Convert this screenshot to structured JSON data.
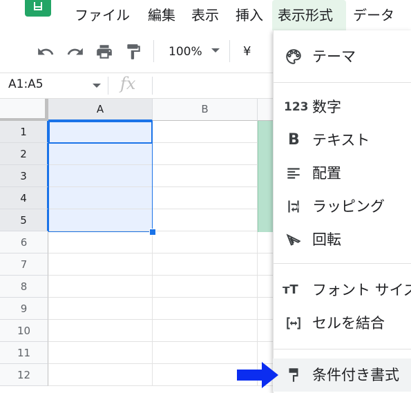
{
  "menu": {
    "items": [
      {
        "label": "ファイル"
      },
      {
        "label": "編集"
      },
      {
        "label": "表示"
      },
      {
        "label": "挿入"
      },
      {
        "label": "表示形式",
        "active": true
      },
      {
        "label": "データ"
      }
    ]
  },
  "toolbar": {
    "zoom": "100%",
    "currency": "¥",
    "icons": [
      "undo-icon",
      "redo-icon",
      "print-icon",
      "paint-format-icon"
    ]
  },
  "formula_bar": {
    "name_box": "A1:A5",
    "fx_label": "fx"
  },
  "grid": {
    "columns": [
      "A",
      "B"
    ],
    "rows": [
      "1",
      "2",
      "3",
      "4",
      "5",
      "6",
      "7",
      "8",
      "9",
      "10",
      "11",
      "12"
    ],
    "selected_range": "A1:A5"
  },
  "format_menu": {
    "items": [
      {
        "label": "テーマ",
        "icon": "palette-icon"
      },
      {
        "label": "数字",
        "icon": "number-123-icon"
      },
      {
        "label": "テキスト",
        "icon": "bold-icon"
      },
      {
        "label": "配置",
        "icon": "align-left-icon"
      },
      {
        "label": "ラッピング",
        "icon": "text-wrap-icon"
      },
      {
        "label": "回転",
        "icon": "text-rotation-icon"
      },
      {
        "label": "フォント サイズ",
        "icon": "font-size-icon"
      },
      {
        "label": "セルを結合",
        "icon": "merge-cells-icon"
      },
      {
        "label": "条件付き書式",
        "icon": "paint-roller-icon"
      }
    ]
  },
  "annotation": {
    "arrow_color": "#0b2df0",
    "points_to": "条件付き書式"
  },
  "colors": {
    "accent": "#1a73e8",
    "active_menu_bg": "#e6f4ea",
    "selection_fill": "#e8f0fe",
    "sheets_green": "#23a566"
  }
}
